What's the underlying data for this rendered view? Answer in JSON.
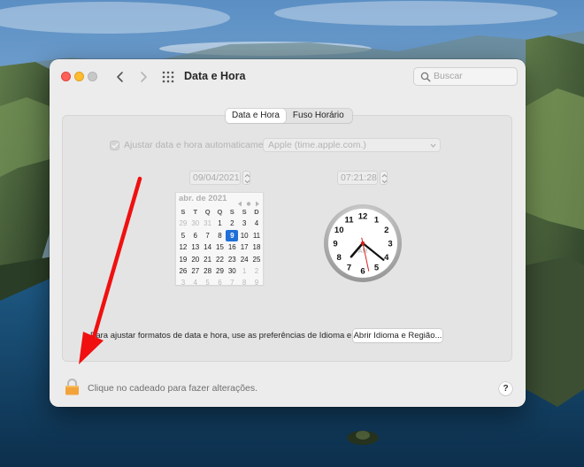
{
  "window": {
    "title": "Data e Hora",
    "search_placeholder": "Buscar"
  },
  "tabs": [
    {
      "label": "Data e Hora",
      "active": true
    },
    {
      "label": "Fuso Horário",
      "active": false
    }
  ],
  "auto": {
    "label": "Ajustar data e hora automaticamente:",
    "checked": true,
    "server": "Apple (time.apple.com.)"
  },
  "date_field": "09/04/2021",
  "time_field": "07:21:28",
  "calendar": {
    "month_label": "abr. de 2021",
    "weekdays": [
      "S",
      "T",
      "Q",
      "Q",
      "S",
      "S",
      "D"
    ],
    "weeks": [
      [
        {
          "d": "29",
          "m": true
        },
        {
          "d": "30",
          "m": true
        },
        {
          "d": "31",
          "m": true
        },
        {
          "d": "1"
        },
        {
          "d": "2"
        },
        {
          "d": "3"
        },
        {
          "d": "4"
        }
      ],
      [
        {
          "d": "5"
        },
        {
          "d": "6"
        },
        {
          "d": "7"
        },
        {
          "d": "8"
        },
        {
          "d": "9",
          "sel": true
        },
        {
          "d": "10"
        },
        {
          "d": "11"
        }
      ],
      [
        {
          "d": "12"
        },
        {
          "d": "13"
        },
        {
          "d": "14"
        },
        {
          "d": "15"
        },
        {
          "d": "16"
        },
        {
          "d": "17"
        },
        {
          "d": "18"
        }
      ],
      [
        {
          "d": "19"
        },
        {
          "d": "20"
        },
        {
          "d": "21"
        },
        {
          "d": "22"
        },
        {
          "d": "23"
        },
        {
          "d": "24"
        },
        {
          "d": "25"
        }
      ],
      [
        {
          "d": "26"
        },
        {
          "d": "27"
        },
        {
          "d": "28"
        },
        {
          "d": "29"
        },
        {
          "d": "30"
        },
        {
          "d": "1",
          "m": true
        },
        {
          "d": "2",
          "m": true
        }
      ],
      [
        {
          "d": "3",
          "m": true
        },
        {
          "d": "4",
          "m": true
        },
        {
          "d": "5",
          "m": true
        },
        {
          "d": "6",
          "m": true
        },
        {
          "d": "7",
          "m": true
        },
        {
          "d": "8",
          "m": true
        },
        {
          "d": "9",
          "m": true
        }
      ]
    ]
  },
  "clock": {
    "numbers": [
      "12",
      "1",
      "2",
      "3",
      "4",
      "5",
      "6",
      "7",
      "8",
      "9",
      "10",
      "11"
    ],
    "am_pm": "AM",
    "hour": 7,
    "minute": 21,
    "second": 28
  },
  "region": {
    "text": "Para ajustar formatos de data e hora, use as preferências de Idioma e Região.",
    "button": "Abrir Idioma e Região..."
  },
  "lock_text": "Clique no cadeado para fazer alterações.",
  "help": "?",
  "colors": {
    "selected_day": "#1f6fd9",
    "annotation_arrow": "#f01010",
    "second_hand": "#d51f1f",
    "lock": "#f2a33a"
  }
}
